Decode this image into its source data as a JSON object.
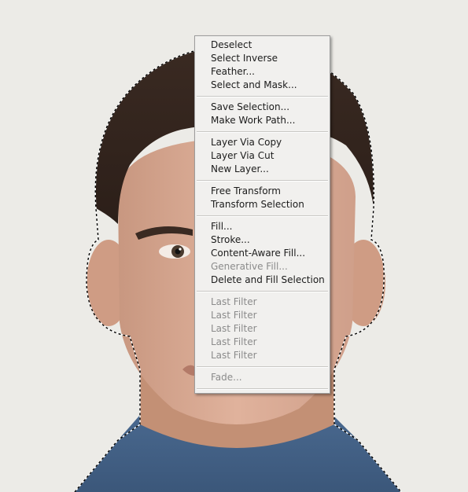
{
  "menu": {
    "groups": [
      [
        {
          "label": "Deselect",
          "enabled": true
        },
        {
          "label": "Select Inverse",
          "enabled": true
        },
        {
          "label": "Feather...",
          "enabled": true
        },
        {
          "label": "Select and Mask...",
          "enabled": true
        }
      ],
      [
        {
          "label": "Save Selection...",
          "enabled": true
        },
        {
          "label": "Make Work Path...",
          "enabled": true
        }
      ],
      [
        {
          "label": "Layer Via Copy",
          "enabled": true
        },
        {
          "label": "Layer Via Cut",
          "enabled": true
        },
        {
          "label": "New Layer...",
          "enabled": true
        }
      ],
      [
        {
          "label": "Free Transform",
          "enabled": true
        },
        {
          "label": "Transform Selection",
          "enabled": true
        }
      ],
      [
        {
          "label": "Fill...",
          "enabled": true
        },
        {
          "label": "Stroke...",
          "enabled": true
        },
        {
          "label": "Content-Aware Fill...",
          "enabled": true
        },
        {
          "label": "Generative Fill...",
          "enabled": false
        },
        {
          "label": "Delete and Fill Selection",
          "enabled": true
        }
      ],
      [
        {
          "label": "Last Filter",
          "enabled": false
        },
        {
          "label": "Last Filter",
          "enabled": false
        },
        {
          "label": "Last Filter",
          "enabled": false
        },
        {
          "label": "Last Filter",
          "enabled": false
        },
        {
          "label": "Last Filter",
          "enabled": false
        }
      ],
      [
        {
          "label": "Fade...",
          "enabled": false
        }
      ]
    ]
  },
  "colors": {
    "menu_background": "#f1f0ee",
    "enabled_text": "#1b1b1b",
    "disabled_text": "#8b8b8b",
    "canvas_background": "#ecebe7",
    "selection_outline": "marching-ants"
  }
}
